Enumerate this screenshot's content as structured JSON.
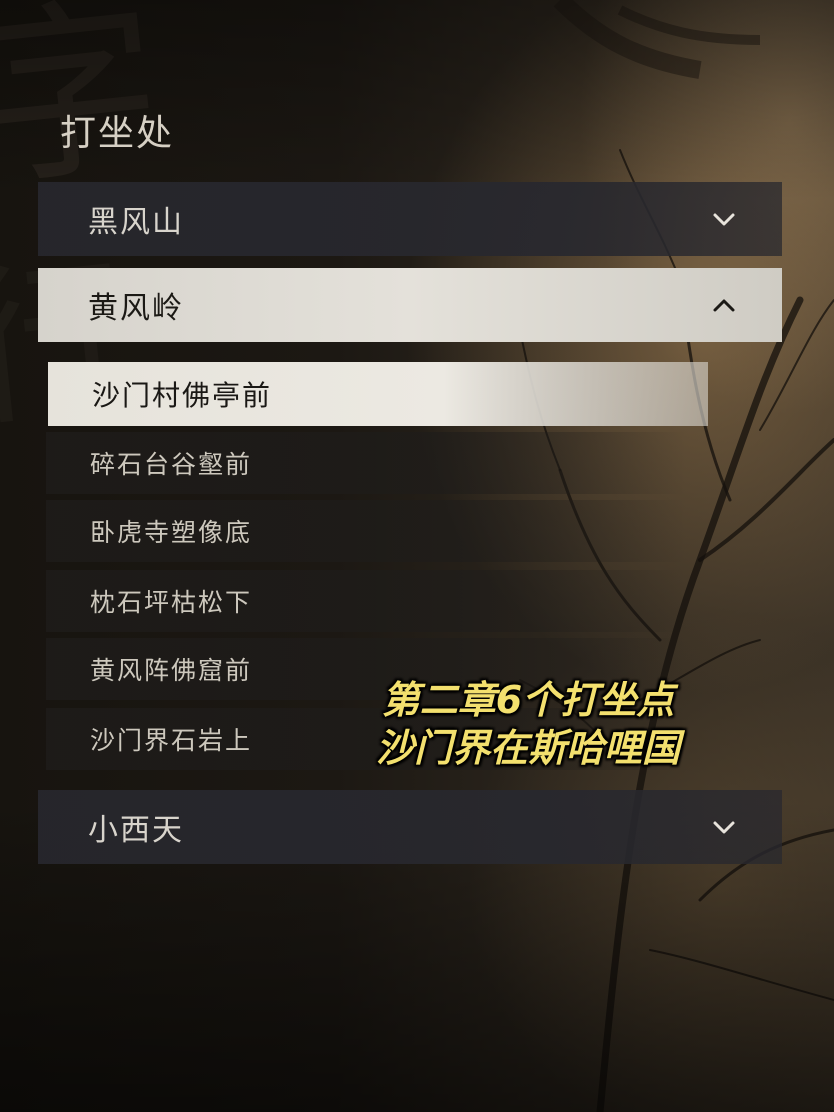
{
  "panel": {
    "title": "打坐处"
  },
  "regions": [
    {
      "label": "黑风山",
      "state": "collapsed"
    },
    {
      "label": "黄风岭",
      "state": "expanded"
    },
    {
      "label": "小西天",
      "state": "collapsed"
    }
  ],
  "locations": [
    {
      "label": "沙门村佛亭前",
      "selected": true
    },
    {
      "label": "碎石台谷壑前",
      "selected": false
    },
    {
      "label": "卧虎寺塑像底",
      "selected": false
    },
    {
      "label": "枕石坪枯松下",
      "selected": false
    },
    {
      "label": "黄风阵佛窟前",
      "selected": false
    },
    {
      "label": "沙门界石岩上",
      "selected": false
    }
  ],
  "overlay_caption": {
    "line1": "第二章6个打坐点",
    "line2": "沙门界在斯哈哩国"
  },
  "icons": {
    "expand": "chevron-down-icon",
    "collapse": "chevron-up-icon"
  },
  "colors": {
    "caption": "#f3e06e",
    "selected_bg": "#e6e3db",
    "collapsed_bg": "#28282e"
  }
}
